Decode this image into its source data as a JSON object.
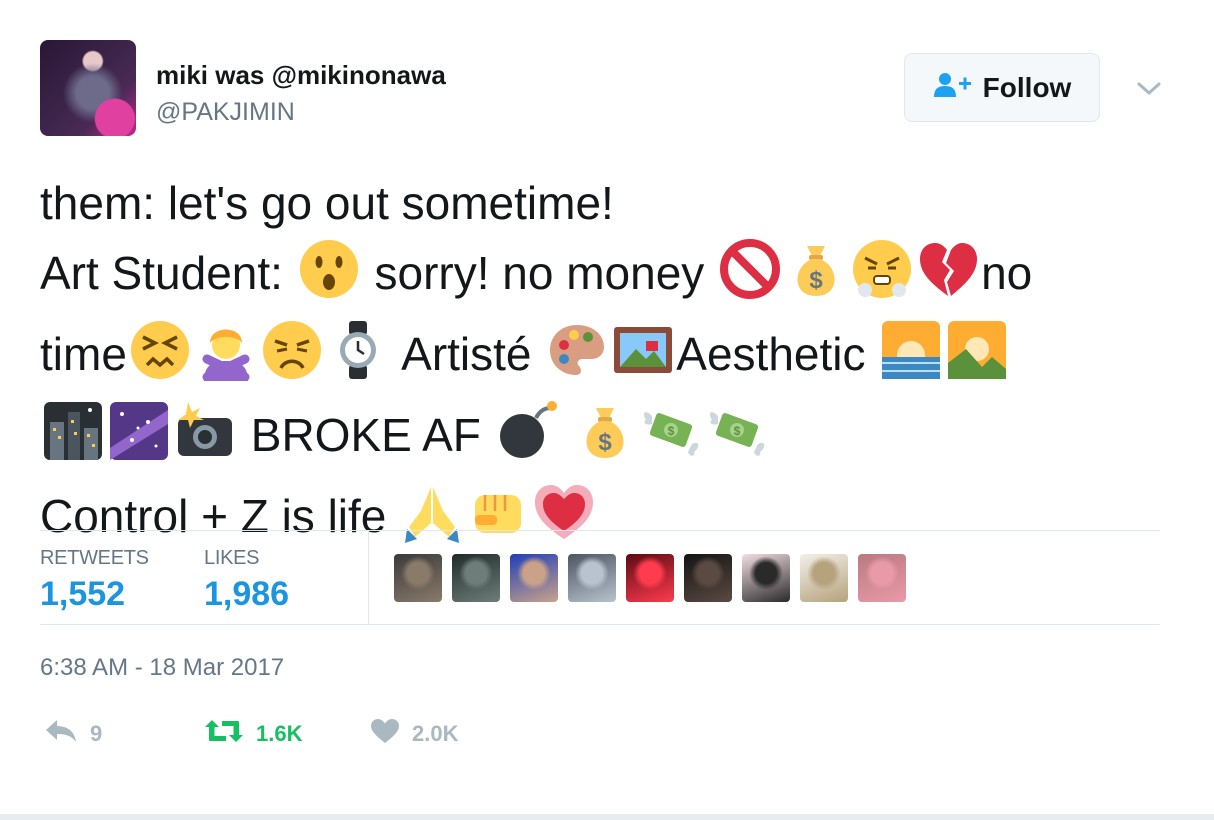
{
  "author": {
    "display_name": "miki was @mikinonawa",
    "handle": "@PAKJIMIN"
  },
  "follow_button": {
    "label": "Follow"
  },
  "tweet": {
    "lines": [
      {
        "parts": [
          {
            "t": "them: let's go out sometime!"
          }
        ]
      },
      {
        "parts": [
          {
            "t": "Art Student: "
          },
          {
            "e": "hushed-face"
          },
          {
            "t": " sorry! no money "
          },
          {
            "e": "prohibited"
          },
          {
            "e": "money-bag"
          },
          {
            "e": "steam-face"
          },
          {
            "e": "broken-heart"
          },
          {
            "t": "no"
          }
        ]
      },
      {
        "parts": [
          {
            "t": "time"
          },
          {
            "e": "confounded-face"
          },
          {
            "e": "gesture-no"
          },
          {
            "e": "persevering-face"
          },
          {
            "e": "watch"
          },
          {
            "t": " Artisté "
          },
          {
            "e": "palette"
          },
          {
            "e": "framed-picture"
          },
          {
            "t": "Aesthetic "
          },
          {
            "e": "sunrise"
          },
          {
            "e": "sunrise-mountains"
          }
        ]
      },
      {
        "parts": [
          {
            "e": "night-city"
          },
          {
            "e": "milky-way"
          },
          {
            "e": "camera-flash"
          },
          {
            "t": " BROKE AF "
          },
          {
            "e": "bomb"
          },
          {
            "t": " "
          },
          {
            "e": "money-bag"
          },
          {
            "e": "money-wings"
          },
          {
            "e": "money-wings"
          }
        ]
      },
      {
        "parts": [
          {
            "t": "Control + Z is life "
          },
          {
            "e": "folded-hands"
          },
          {
            "e": "fist"
          },
          {
            "e": "growing-heart"
          }
        ]
      }
    ]
  },
  "stats": {
    "retweets_label": "RETWEETS",
    "retweets_value": "1,552",
    "likes_label": "LIKES",
    "likes_value": "1,986"
  },
  "likers": [
    {
      "c1": "#3a3a3a",
      "c2": "#8a7a6a"
    },
    {
      "c1": "#1f2b2a",
      "c2": "#6e7d7a"
    },
    {
      "c1": "#1f3fb8",
      "c2": "#caa28a"
    },
    {
      "c1": "#4d5561",
      "c2": "#b7c3cf"
    },
    {
      "c1": "#5a0a12",
      "c2": "#ff3b4e"
    },
    {
      "c1": "#141414",
      "c2": "#5b4a42"
    },
    {
      "c1": "#f3dfe3",
      "c2": "#2a2a2a"
    },
    {
      "c1": "#f2f0ea",
      "c2": "#b6a27c"
    },
    {
      "c1": "#b87a7f",
      "c2": "#e99aa8"
    }
  ],
  "timestamp": "6:38 AM - 18 Mar 2017",
  "actions": {
    "reply_count": "9",
    "retweet_count": "1.6K",
    "like_count": "2.0K"
  },
  "colors": {
    "accent": "#1b95e0",
    "retweet_green": "#17bf63",
    "muted": "#657786",
    "icon_gray": "#aab8c2"
  }
}
